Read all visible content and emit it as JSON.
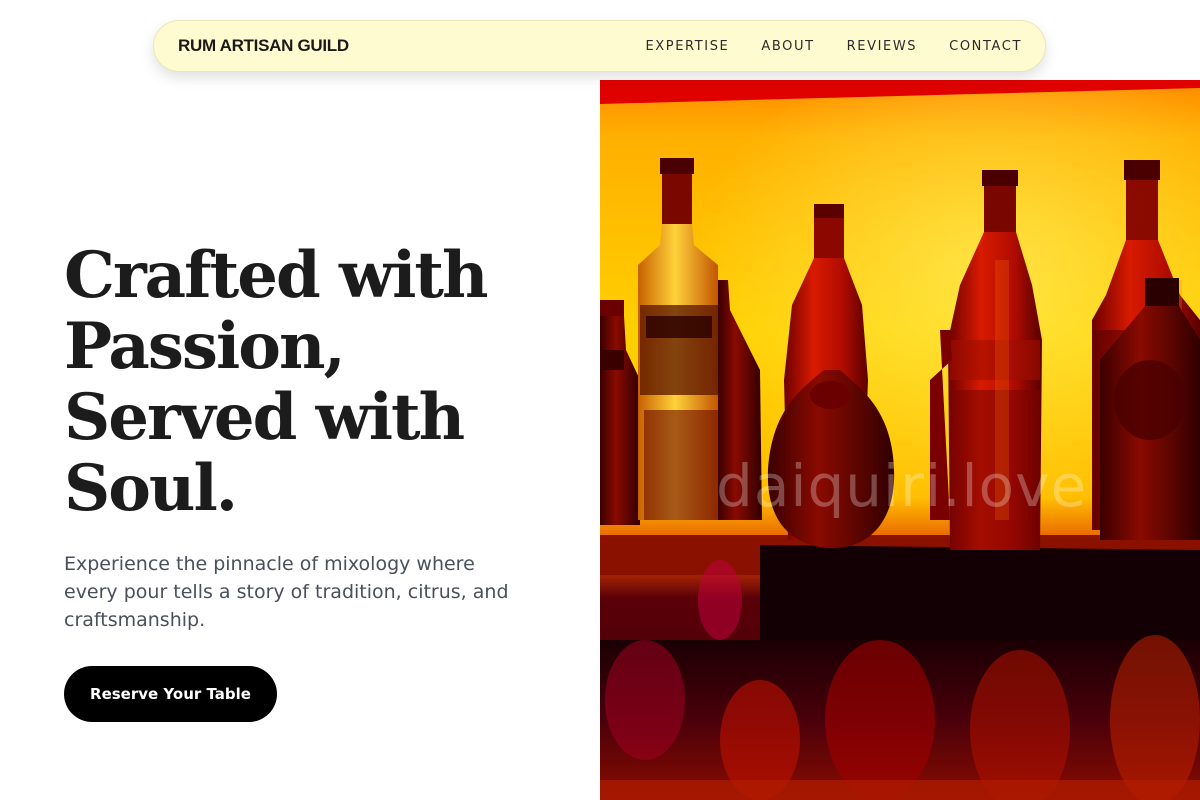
{
  "nav": {
    "brand": "RUM ARTISAN GUILD",
    "links": [
      {
        "label": "EXPERTISE"
      },
      {
        "label": "ABOUT"
      },
      {
        "label": "REVIEWS"
      },
      {
        "label": "CONTACT"
      }
    ]
  },
  "hero": {
    "title_lines": [
      "Crafted with",
      "Passion,",
      "Served with",
      "Soul."
    ],
    "subtitle": "Experience the pinnacle of mixology where every pour tells a story of tradition, citrus, and craftsmanship.",
    "cta_label": "Reserve Your Table",
    "image_watermark": "daiquiri.love"
  },
  "colors": {
    "navbar_bg": "#fffbd0",
    "cta_bg": "#000000",
    "cta_text": "#ffffff",
    "title_text": "#1c1c1c",
    "subtitle_text": "#4a4f5a",
    "image_glow": "#ffc400",
    "image_shadow": "#c00000"
  }
}
